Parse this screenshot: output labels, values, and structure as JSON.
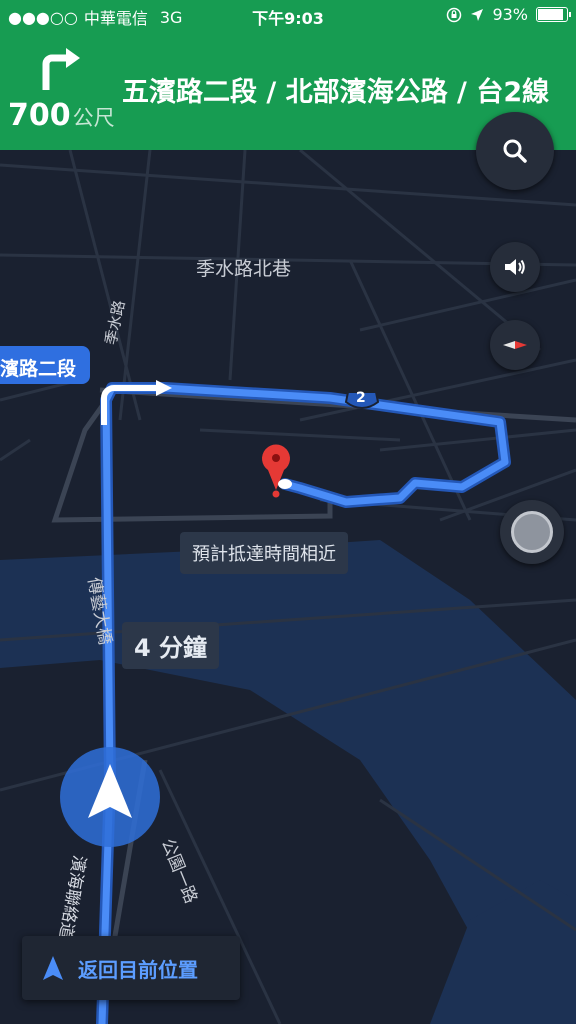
{
  "status_bar": {
    "signal": "●●●○○",
    "carrier": "中華電信",
    "network": "3G",
    "time": "下午9:03",
    "battery": "93%",
    "battery_level": 0.93
  },
  "nav_header": {
    "turn_icon": "turn-right-arrow",
    "distance": "700",
    "distance_unit": "公尺",
    "street": "五濱路二段 / 北部濱海公路 / 台2線"
  },
  "map": {
    "labels": {
      "lane": "季水路北巷",
      "road_vertical": "季水路",
      "bridge": "傳藝大橋",
      "park_road": "公園一路",
      "highway": "濱海聯絡道"
    },
    "route_shield": "2",
    "current_street_tag": "濱路二段",
    "eta_note": "預計抵達時間相近",
    "eta": "4 分鐘"
  },
  "controls": {
    "search_icon": "search-icon",
    "sound_icon": "volume-icon",
    "compass_icon": "compass-icon",
    "mic_icon": "microphone-icon",
    "recenter_label": "返回目前位置"
  },
  "colors": {
    "header": "#179c52",
    "route": "#4a8cf7",
    "map_bg": "#1a2130"
  }
}
